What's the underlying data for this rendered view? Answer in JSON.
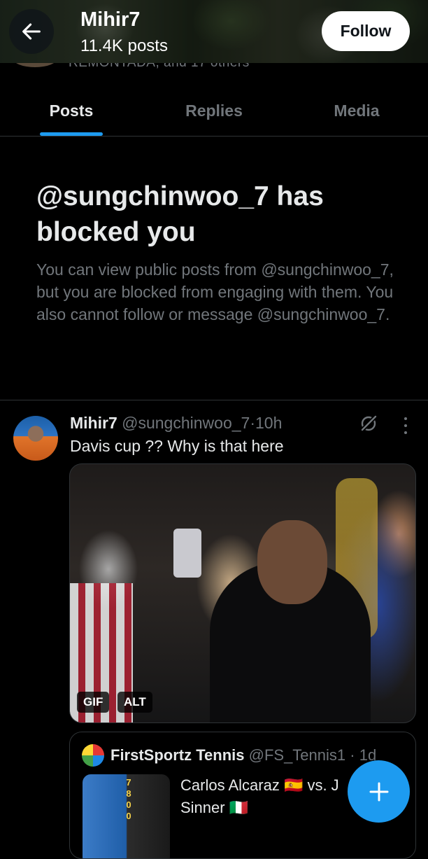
{
  "header": {
    "name": "Mihir7",
    "post_count": "11.4K posts",
    "follow_label": "Follow",
    "peek_text": "REMONTADA, and 17 others"
  },
  "tabs": [
    {
      "label": "Posts",
      "active": true
    },
    {
      "label": "Replies",
      "active": false
    },
    {
      "label": "Media",
      "active": false
    }
  ],
  "blocked": {
    "title": "@sungchinwoo_7 has blocked you",
    "description": "You can view public posts from @sungchinwoo_7, but you are blocked from engaging with them. You also cannot follow or message @sungchinwoo_7."
  },
  "post": {
    "author": "Mihir7",
    "handle": "@sungchinwoo_7",
    "separator": "·",
    "time": "10h",
    "text": "Davis cup ?? Why is that here",
    "media_badges": {
      "gif": "GIF",
      "alt": "ALT"
    },
    "quote": {
      "author": "FirstSportz Tennis",
      "handle": "@FS_Tennis1",
      "time": "· 1d",
      "text": "Carlos Alcaraz 🇪🇸 vs. J",
      "text_line2": "Sinner 🇮🇹",
      "thumb_scores": [
        "7",
        "8",
        "0",
        "0"
      ]
    }
  },
  "icons": {
    "back": "arrow-left-icon",
    "grok": "grok-icon",
    "more": "more-vertical-icon",
    "compose": "plus-icon"
  },
  "colors": {
    "accent": "#1d9bf0",
    "background": "#000000",
    "secondary_text": "#71767b",
    "border": "#2f3336"
  }
}
